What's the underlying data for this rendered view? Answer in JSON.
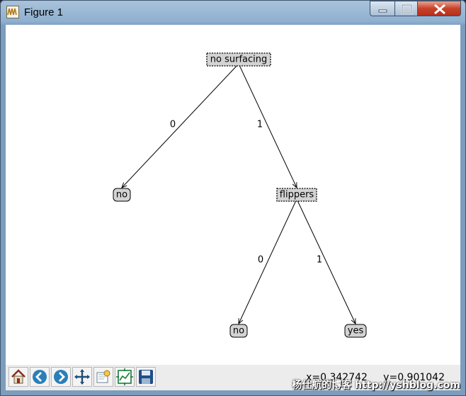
{
  "window": {
    "title": "Figure 1",
    "controls": {
      "minimize": "minimize",
      "maximize": "maximize",
      "close": "close"
    }
  },
  "tree": {
    "nodes": [
      {
        "id": "n_root",
        "label": "no surfacing",
        "kind": "decision"
      },
      {
        "id": "n_no1",
        "label": "no",
        "kind": "leaf"
      },
      {
        "id": "n_flippers",
        "label": "flippers",
        "kind": "decision"
      },
      {
        "id": "n_no2",
        "label": "no",
        "kind": "leaf"
      },
      {
        "id": "n_yes",
        "label": "yes",
        "kind": "leaf"
      }
    ],
    "edges": [
      {
        "from": "n_root",
        "to": "n_no1",
        "label": "0"
      },
      {
        "from": "n_root",
        "to": "n_flippers",
        "label": "1"
      },
      {
        "from": "n_flippers",
        "to": "n_no2",
        "label": "0"
      },
      {
        "from": "n_flippers",
        "to": "n_yes",
        "label": "1"
      }
    ]
  },
  "toolbar": {
    "buttons": [
      {
        "name": "home-icon",
        "title": "home"
      },
      {
        "name": "back-icon",
        "title": "back"
      },
      {
        "name": "forward-icon",
        "title": "forward"
      },
      {
        "name": "pan-icon",
        "title": "pan"
      },
      {
        "name": "zoom-icon",
        "title": "zoom"
      },
      {
        "name": "subplots-icon",
        "title": "configure subplots"
      },
      {
        "name": "save-icon",
        "title": "save"
      }
    ],
    "coords": "x=0.342742     y=0.901042"
  },
  "watermark": "杨仕航的博客 http://yshblog.com",
  "colors": {
    "decision_fill": "#d3d3d3",
    "leaf_fill": "#d3d3d3",
    "edge": "#000000",
    "toolbar_bg": "#ececec"
  }
}
